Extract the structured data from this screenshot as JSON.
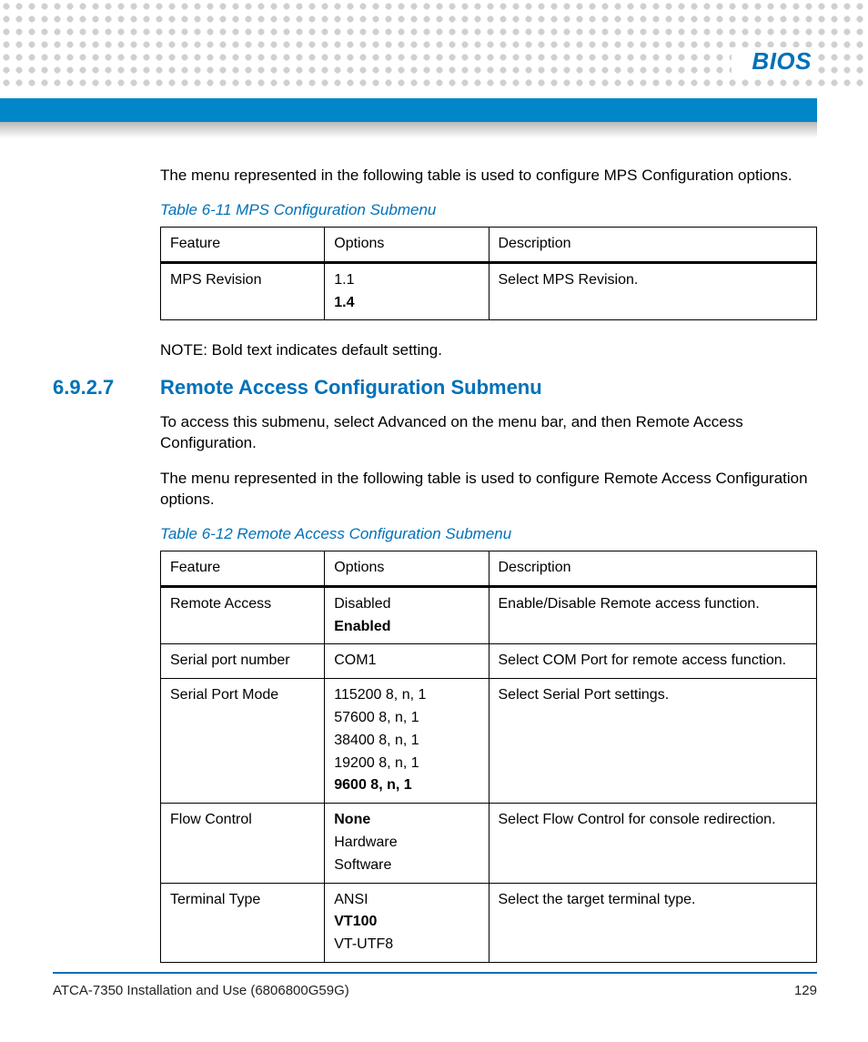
{
  "header": {
    "chapter_title": "BIOS"
  },
  "intro_para": "The menu represented in the following table is used to configure MPS Configuration options.",
  "table611": {
    "caption": "Table 6-11 MPS Configuration Submenu",
    "headers": [
      "Feature",
      "Options",
      "Description"
    ],
    "rows": [
      {
        "feature": "MPS Revision",
        "options": [
          {
            "text": "1.1",
            "default": false
          },
          {
            "text": "1.4",
            "default": true
          }
        ],
        "description": "Select MPS Revision."
      }
    ]
  },
  "note_text": "NOTE: Bold text indicates default setting.",
  "section": {
    "number": "6.9.2.7",
    "title": "Remote Access Configuration Submenu",
    "p1": "To access this submenu, select Advanced on the menu bar, and then Remote Access Configuration.",
    "p2": "The menu represented in the following table is used to configure Remote Access Configuration options."
  },
  "table612": {
    "caption": "Table 6-12 Remote Access Configuration Submenu",
    "headers": [
      "Feature",
      "Options",
      "Description"
    ],
    "rows": [
      {
        "feature": "Remote Access",
        "options": [
          {
            "text": "Disabled",
            "default": false
          },
          {
            "text": "Enabled",
            "default": true
          }
        ],
        "description": "Enable/Disable Remote access function."
      },
      {
        "feature": "Serial port number",
        "options": [
          {
            "text": "COM1",
            "default": false
          }
        ],
        "description": "Select COM Port for remote access function."
      },
      {
        "feature": "Serial Port Mode",
        "options": [
          {
            "text": "115200 8, n, 1",
            "default": false
          },
          {
            "text": "57600 8, n, 1",
            "default": false
          },
          {
            "text": "38400 8, n, 1",
            "default": false
          },
          {
            "text": "19200 8, n, 1",
            "default": false
          },
          {
            "text": "9600 8, n, 1",
            "default": true
          }
        ],
        "description": "Select Serial Port settings."
      },
      {
        "feature": "Flow Control",
        "options": [
          {
            "text": "None",
            "default": true
          },
          {
            "text": "Hardware",
            "default": false
          },
          {
            "text": "Software",
            "default": false
          }
        ],
        "description": "Select Flow Control for console redirection."
      },
      {
        "feature": "Terminal Type",
        "options": [
          {
            "text": "ANSI",
            "default": false
          },
          {
            "text": "VT100",
            "default": true
          },
          {
            "text": "VT-UTF8",
            "default": false
          }
        ],
        "description": "Select the target terminal type."
      }
    ]
  },
  "footer": {
    "doc_title": "ATCA-7350 Installation and Use (6806800G59G)",
    "page_number": "129"
  }
}
